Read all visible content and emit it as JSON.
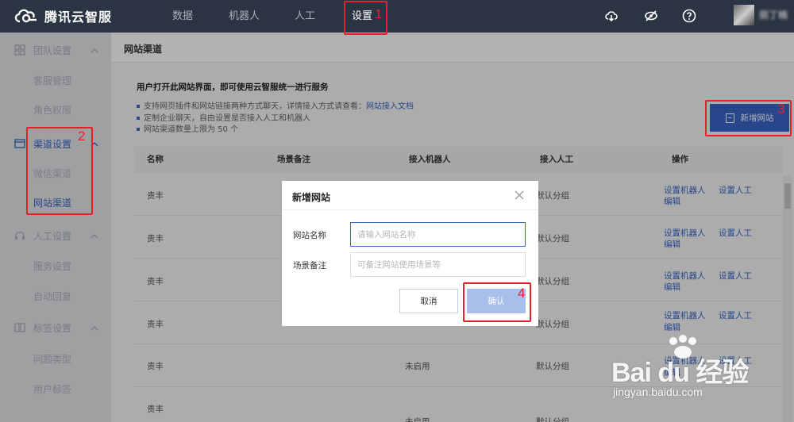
{
  "app": {
    "logo_text": "腾讯云智服"
  },
  "topnav": {
    "items": [
      {
        "label": "数据"
      },
      {
        "label": "机器人"
      },
      {
        "label": "人工"
      },
      {
        "label": "设置"
      }
    ],
    "active": "设置",
    "username": "丽丁楠"
  },
  "sidebar": {
    "groups": [
      {
        "label": "团队设置",
        "icon": "grid-icon",
        "subs": [
          "客服管理",
          "角色权限"
        ]
      },
      {
        "label": "渠道设置",
        "icon": "window-icon",
        "subs": [
          "微信渠道",
          "网站渠道"
        ]
      },
      {
        "label": "人工设置",
        "icon": "headset-icon",
        "subs": [
          "服务设置",
          "自动回复"
        ]
      },
      {
        "label": "标签设置",
        "icon": "tag-icon",
        "subs": [
          "问题类型",
          "用户标签"
        ]
      }
    ],
    "active_group": "渠道设置",
    "active_sub": "网站渠道"
  },
  "page": {
    "title": "网站渠道",
    "intro_title": "用户打开此网站界面，即可使用云智服统一进行服务",
    "intro_lines": [
      {
        "text": "支持网页插件和网站链接两种方式聊天，详情接入方式请查看：",
        "link": "网站接入文档"
      },
      {
        "text": "定制企业聊天，自由设置是否接入人工和机器人",
        "link": ""
      },
      {
        "text": "网站渠道数量上限为 50 个",
        "link": ""
      }
    ],
    "add_button": "新增网站"
  },
  "table": {
    "headers": [
      "名称",
      "场景备注",
      "接入机器人",
      "接入人工",
      "操作"
    ],
    "rows": [
      {
        "name": "贵丰",
        "note": "",
        "robot": "",
        "human": "默认分组",
        "ops": [
          "设置机器人",
          "设置人工",
          "编辑"
        ]
      },
      {
        "name": "贵丰",
        "note": "",
        "robot": "",
        "human": "默认分组",
        "ops": [
          "设置机器人",
          "设置人工",
          "编辑"
        ]
      },
      {
        "name": "贵丰",
        "note": "",
        "robot": "",
        "human": "默认分组",
        "ops": [
          "设置机器人",
          "设置人工",
          "编辑"
        ]
      },
      {
        "name": "贵丰",
        "note": "",
        "robot": "",
        "human": "默认分组",
        "ops": [
          "设置机器人",
          "设置人工",
          "编辑"
        ]
      },
      {
        "name": "贵丰",
        "note": "",
        "robot": "未启用",
        "human": "默认分组",
        "ops": [
          "设置机器人",
          "设置人工",
          "编辑"
        ]
      },
      {
        "name": "贵丰",
        "note": "",
        "robot": "未启用",
        "human": "默认分组",
        "ops": [
          "",
          "",
          ""
        ]
      }
    ]
  },
  "modal": {
    "title": "新增网站",
    "fields": [
      {
        "label": "网站名称",
        "placeholder": "请输入网站名称",
        "value": ""
      },
      {
        "label": "场景备注",
        "placeholder": "可备注网站使用场景等",
        "value": ""
      }
    ],
    "cancel": "取消",
    "confirm": "确认"
  },
  "annotations": [
    "1",
    "2",
    "3",
    "4"
  ],
  "colors": {
    "accent": "#3a66c6",
    "topbar": "#2b3442",
    "annotation": "#e8202a",
    "confirm_disabled": "#a9c0ea"
  },
  "watermark": {
    "brand": "Bai du 经验",
    "url": "jingyan.baidu.com"
  }
}
